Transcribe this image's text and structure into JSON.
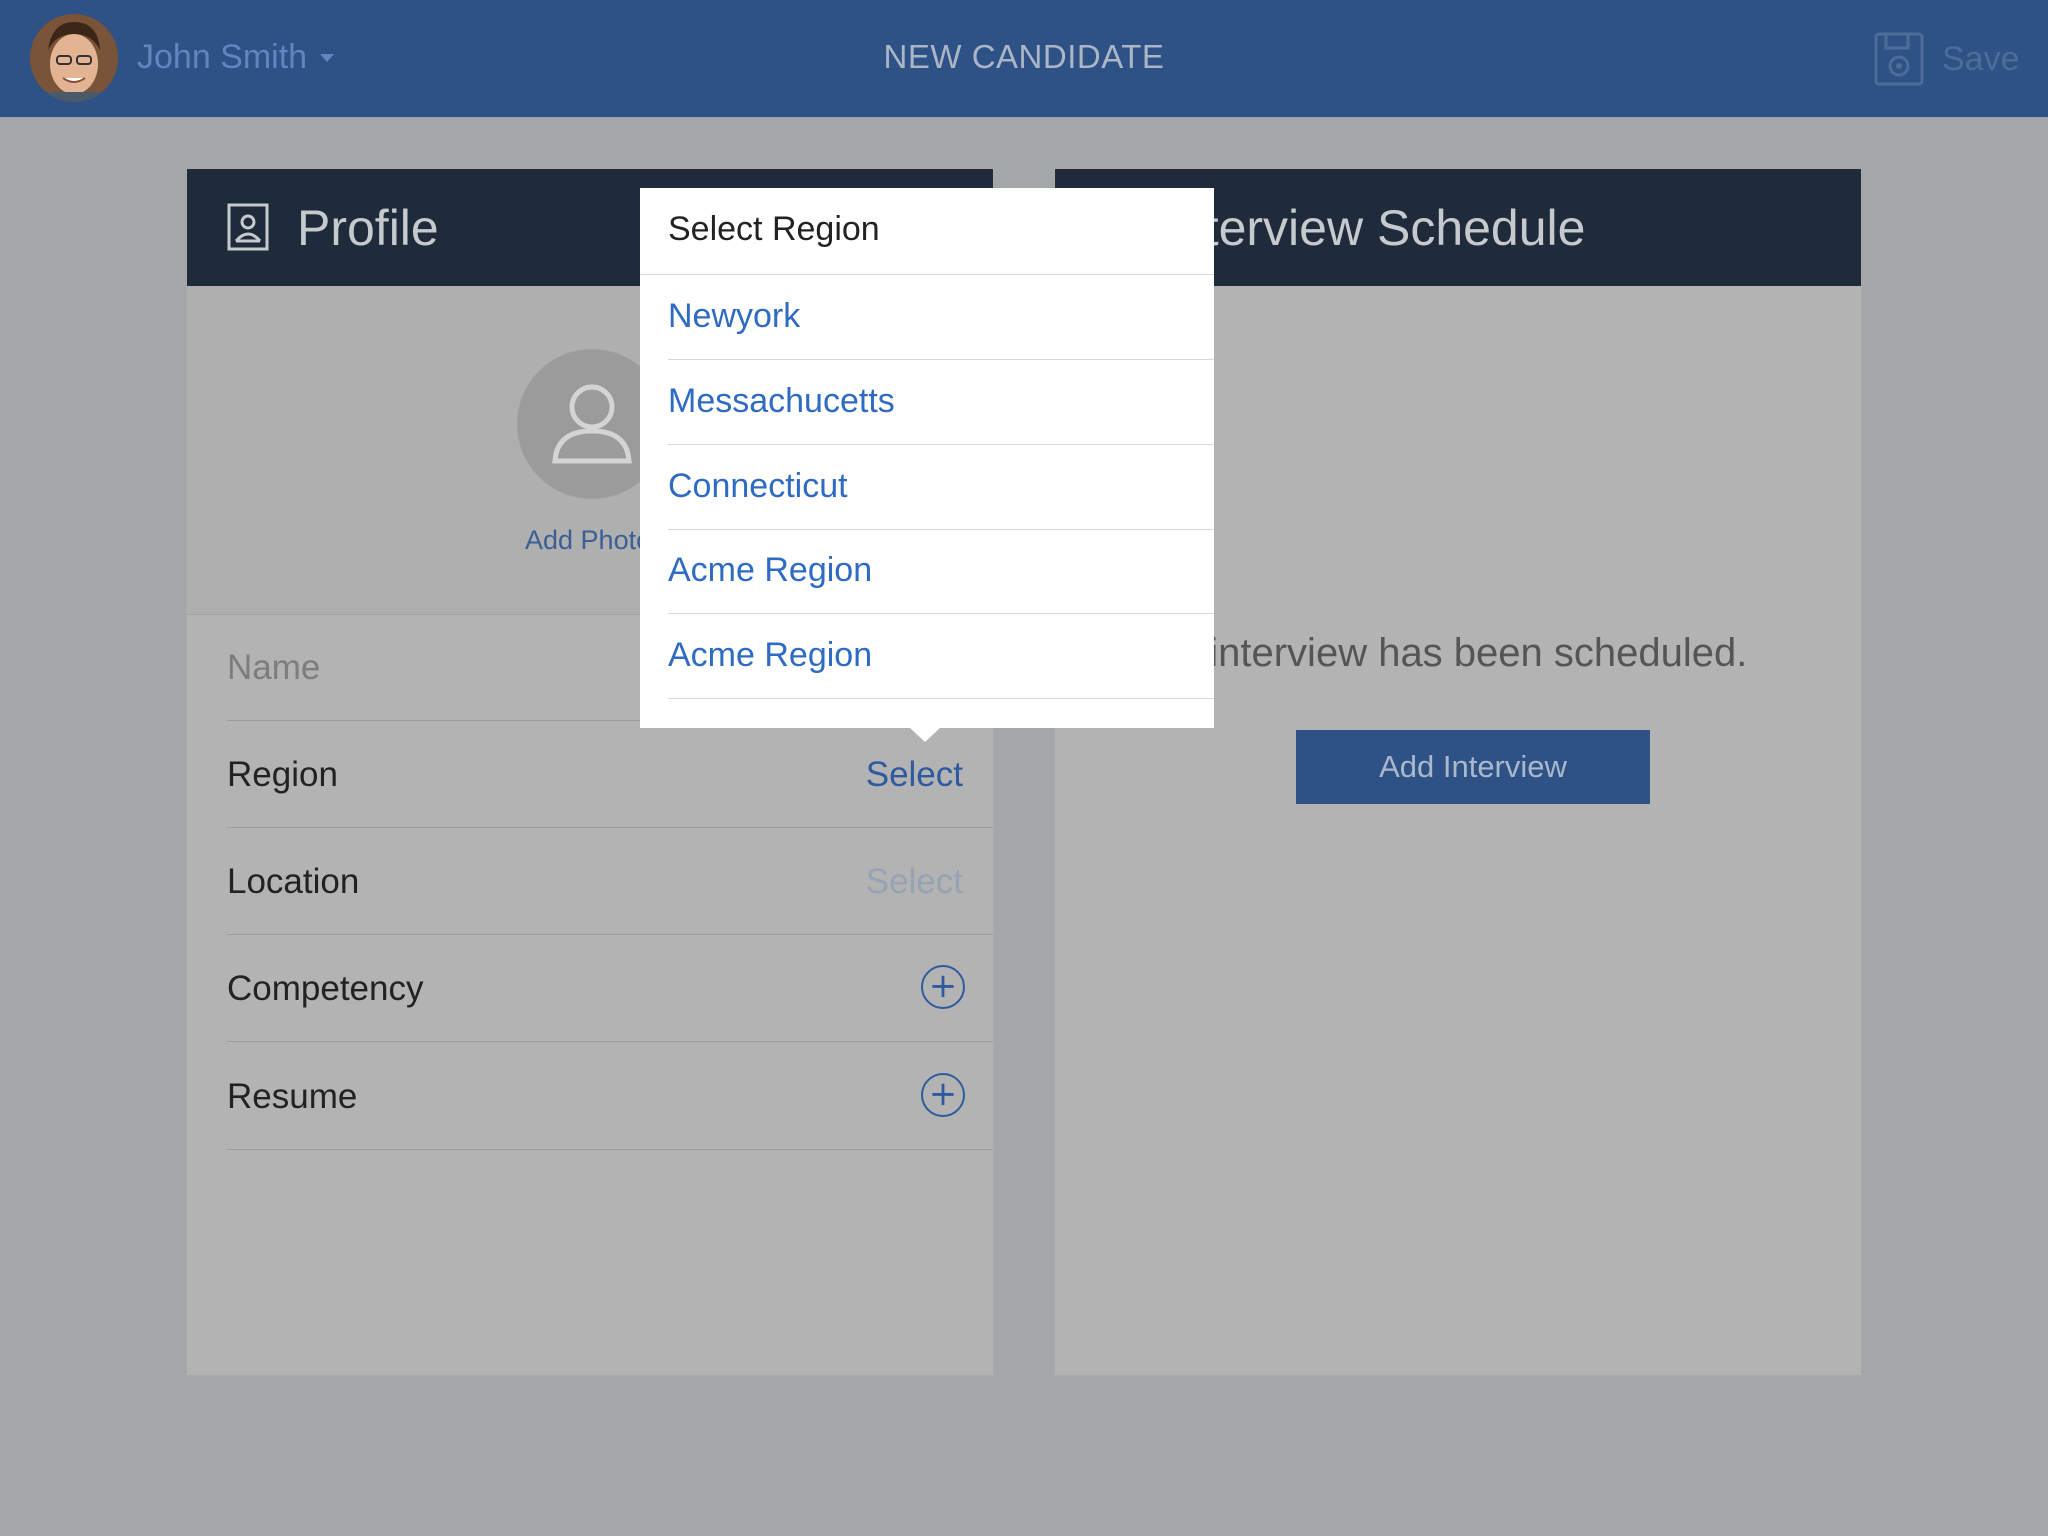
{
  "header": {
    "user_name": "John Smith",
    "title": "NEW CANDIDATE",
    "save_label": "Save"
  },
  "profile": {
    "title": "Profile",
    "add_photo_label": "Add Photo",
    "rows": [
      {
        "label": "Name",
        "value": ""
      },
      {
        "label": "Region",
        "value": "Select"
      },
      {
        "label": "Location",
        "value": "Select"
      },
      {
        "label": "Competency",
        "value": ""
      },
      {
        "label": "Resume",
        "value": ""
      }
    ]
  },
  "schedule": {
    "title": "Interview Schedule",
    "empty_message": "No interview has been scheduled.",
    "add_button_label": "Add Interview"
  },
  "region_popover": {
    "title": "Select Region",
    "options": [
      "Newyork",
      "Messachucetts",
      "Connecticut",
      "Acme Region",
      "Acme Region"
    ]
  },
  "colors": {
    "topbar": "#2e5186",
    "card_header": "#1f2a3a",
    "link": "#2f6bc2",
    "overlay_background": "#a4a7a8"
  }
}
